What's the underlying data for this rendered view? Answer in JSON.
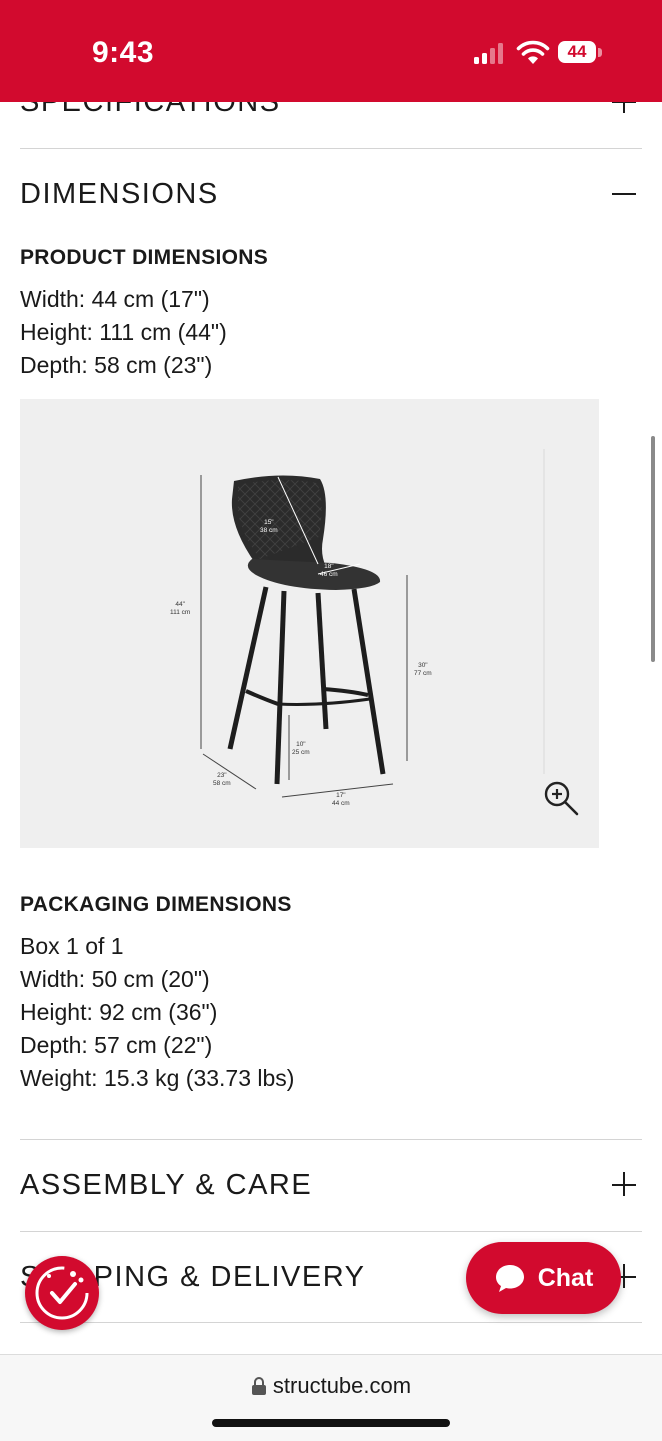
{
  "status": {
    "time": "9:43",
    "battery": "44"
  },
  "sections": {
    "specifications": "SPECIFICATIONS",
    "dimensions": "DIMENSIONS",
    "assembly": "ASSEMBLY & CARE",
    "shipping": "SHIPPING & DELIVERY"
  },
  "product_dimensions": {
    "heading": "PRODUCT DIMENSIONS",
    "width": "Width: 44 cm (17\")",
    "height": "Height: 111 cm (44\")",
    "depth": "Depth: 58 cm (23\")"
  },
  "diagram_labels": {
    "overall_height": [
      "44\"",
      "111 cm"
    ],
    "back_height": [
      "15\"",
      "38 cm"
    ],
    "seat_depth": [
      "18\"",
      "46 cm"
    ],
    "seat_height": [
      "30\"",
      "77 cm"
    ],
    "footrest": [
      "10\"",
      "25 cm"
    ],
    "depth": [
      "23\"",
      "58 cm"
    ],
    "width": [
      "17\"",
      "44 cm"
    ]
  },
  "packaging_dimensions": {
    "heading": "PACKAGING DIMENSIONS",
    "box": "Box 1 of 1",
    "width": "Width: 50 cm (20\")",
    "height": "Height: 92 cm (36\")",
    "depth": "Depth: 57 cm (22\")",
    "weight": "Weight: 15.3 kg (33.73 lbs)"
  },
  "chat": {
    "label": "Chat"
  },
  "browser": {
    "url": "structube.com"
  },
  "colors": {
    "brand_red": "#d20a2e"
  },
  "icons": [
    "signal-icon",
    "wifi-icon",
    "battery-icon",
    "zoom-in-icon",
    "chat-bubble-icon",
    "rewards-icon",
    "lock-icon",
    "plus-icon",
    "minus-icon"
  ]
}
